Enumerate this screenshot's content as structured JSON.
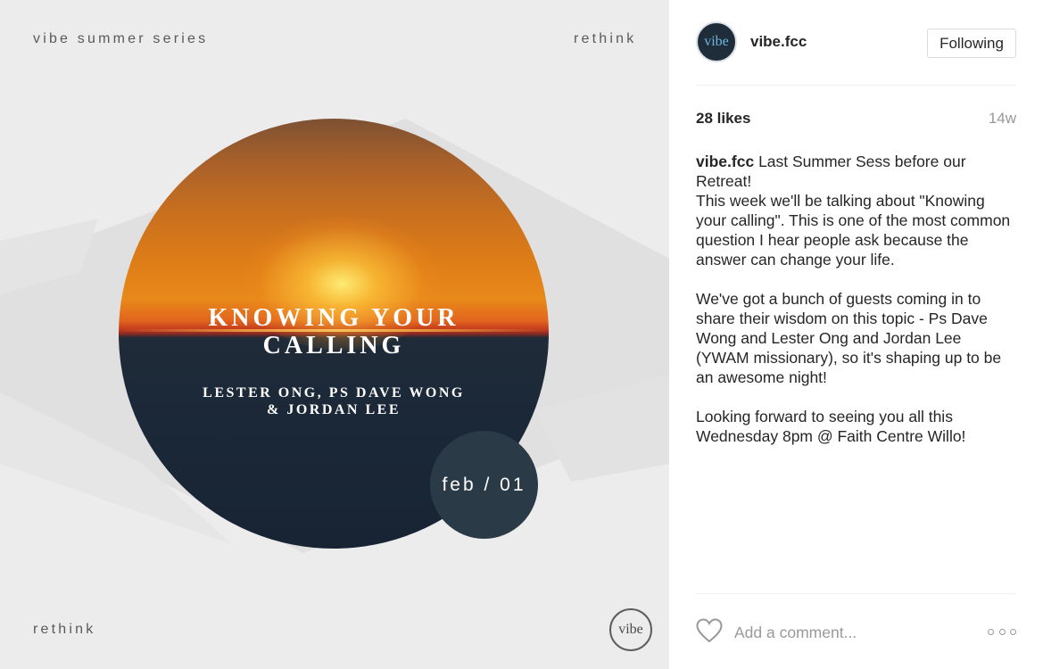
{
  "poster": {
    "series_label": "vibe summer series",
    "brand_top": "rethink",
    "brand_bottom": "rethink",
    "title_line1": "KNOWING YOUR",
    "title_line2": "CALLING",
    "speakers_line1": "LESTER ONG, PS DAVE WONG",
    "speakers_line2": "& JORDAN LEE",
    "date": "feb / 01",
    "logo_text": "vibe"
  },
  "post": {
    "avatar_text": "vibe",
    "username": "vibe.fcc",
    "follow_label": "Following",
    "likes": "28 likes",
    "time": "14w",
    "caption_user": "vibe.fcc",
    "caption_p1": "Last Summer Sess before our Retreat!",
    "caption_p2": "This week we'll be talking about \"Knowing your calling\". This is one of the most common question I hear people ask because the answer can change your life.",
    "caption_p3": "We've got a bunch of guests coming in to share their wisdom on this topic - Ps Dave Wong and Lester Ong and Jordan Lee (YWAM missionary), so it's shaping up to be an awesome night!",
    "caption_p4": "Looking forward to seeing you all this Wednesday 8pm @ Faith Centre Willo!",
    "comment_placeholder": "Add a comment..."
  },
  "icons": {
    "like": "heart-icon",
    "more": "more-options-icon"
  },
  "colors": {
    "date_circle": "#2a3b47",
    "poster_bg": "#ececec",
    "muted_text": "#999999"
  }
}
